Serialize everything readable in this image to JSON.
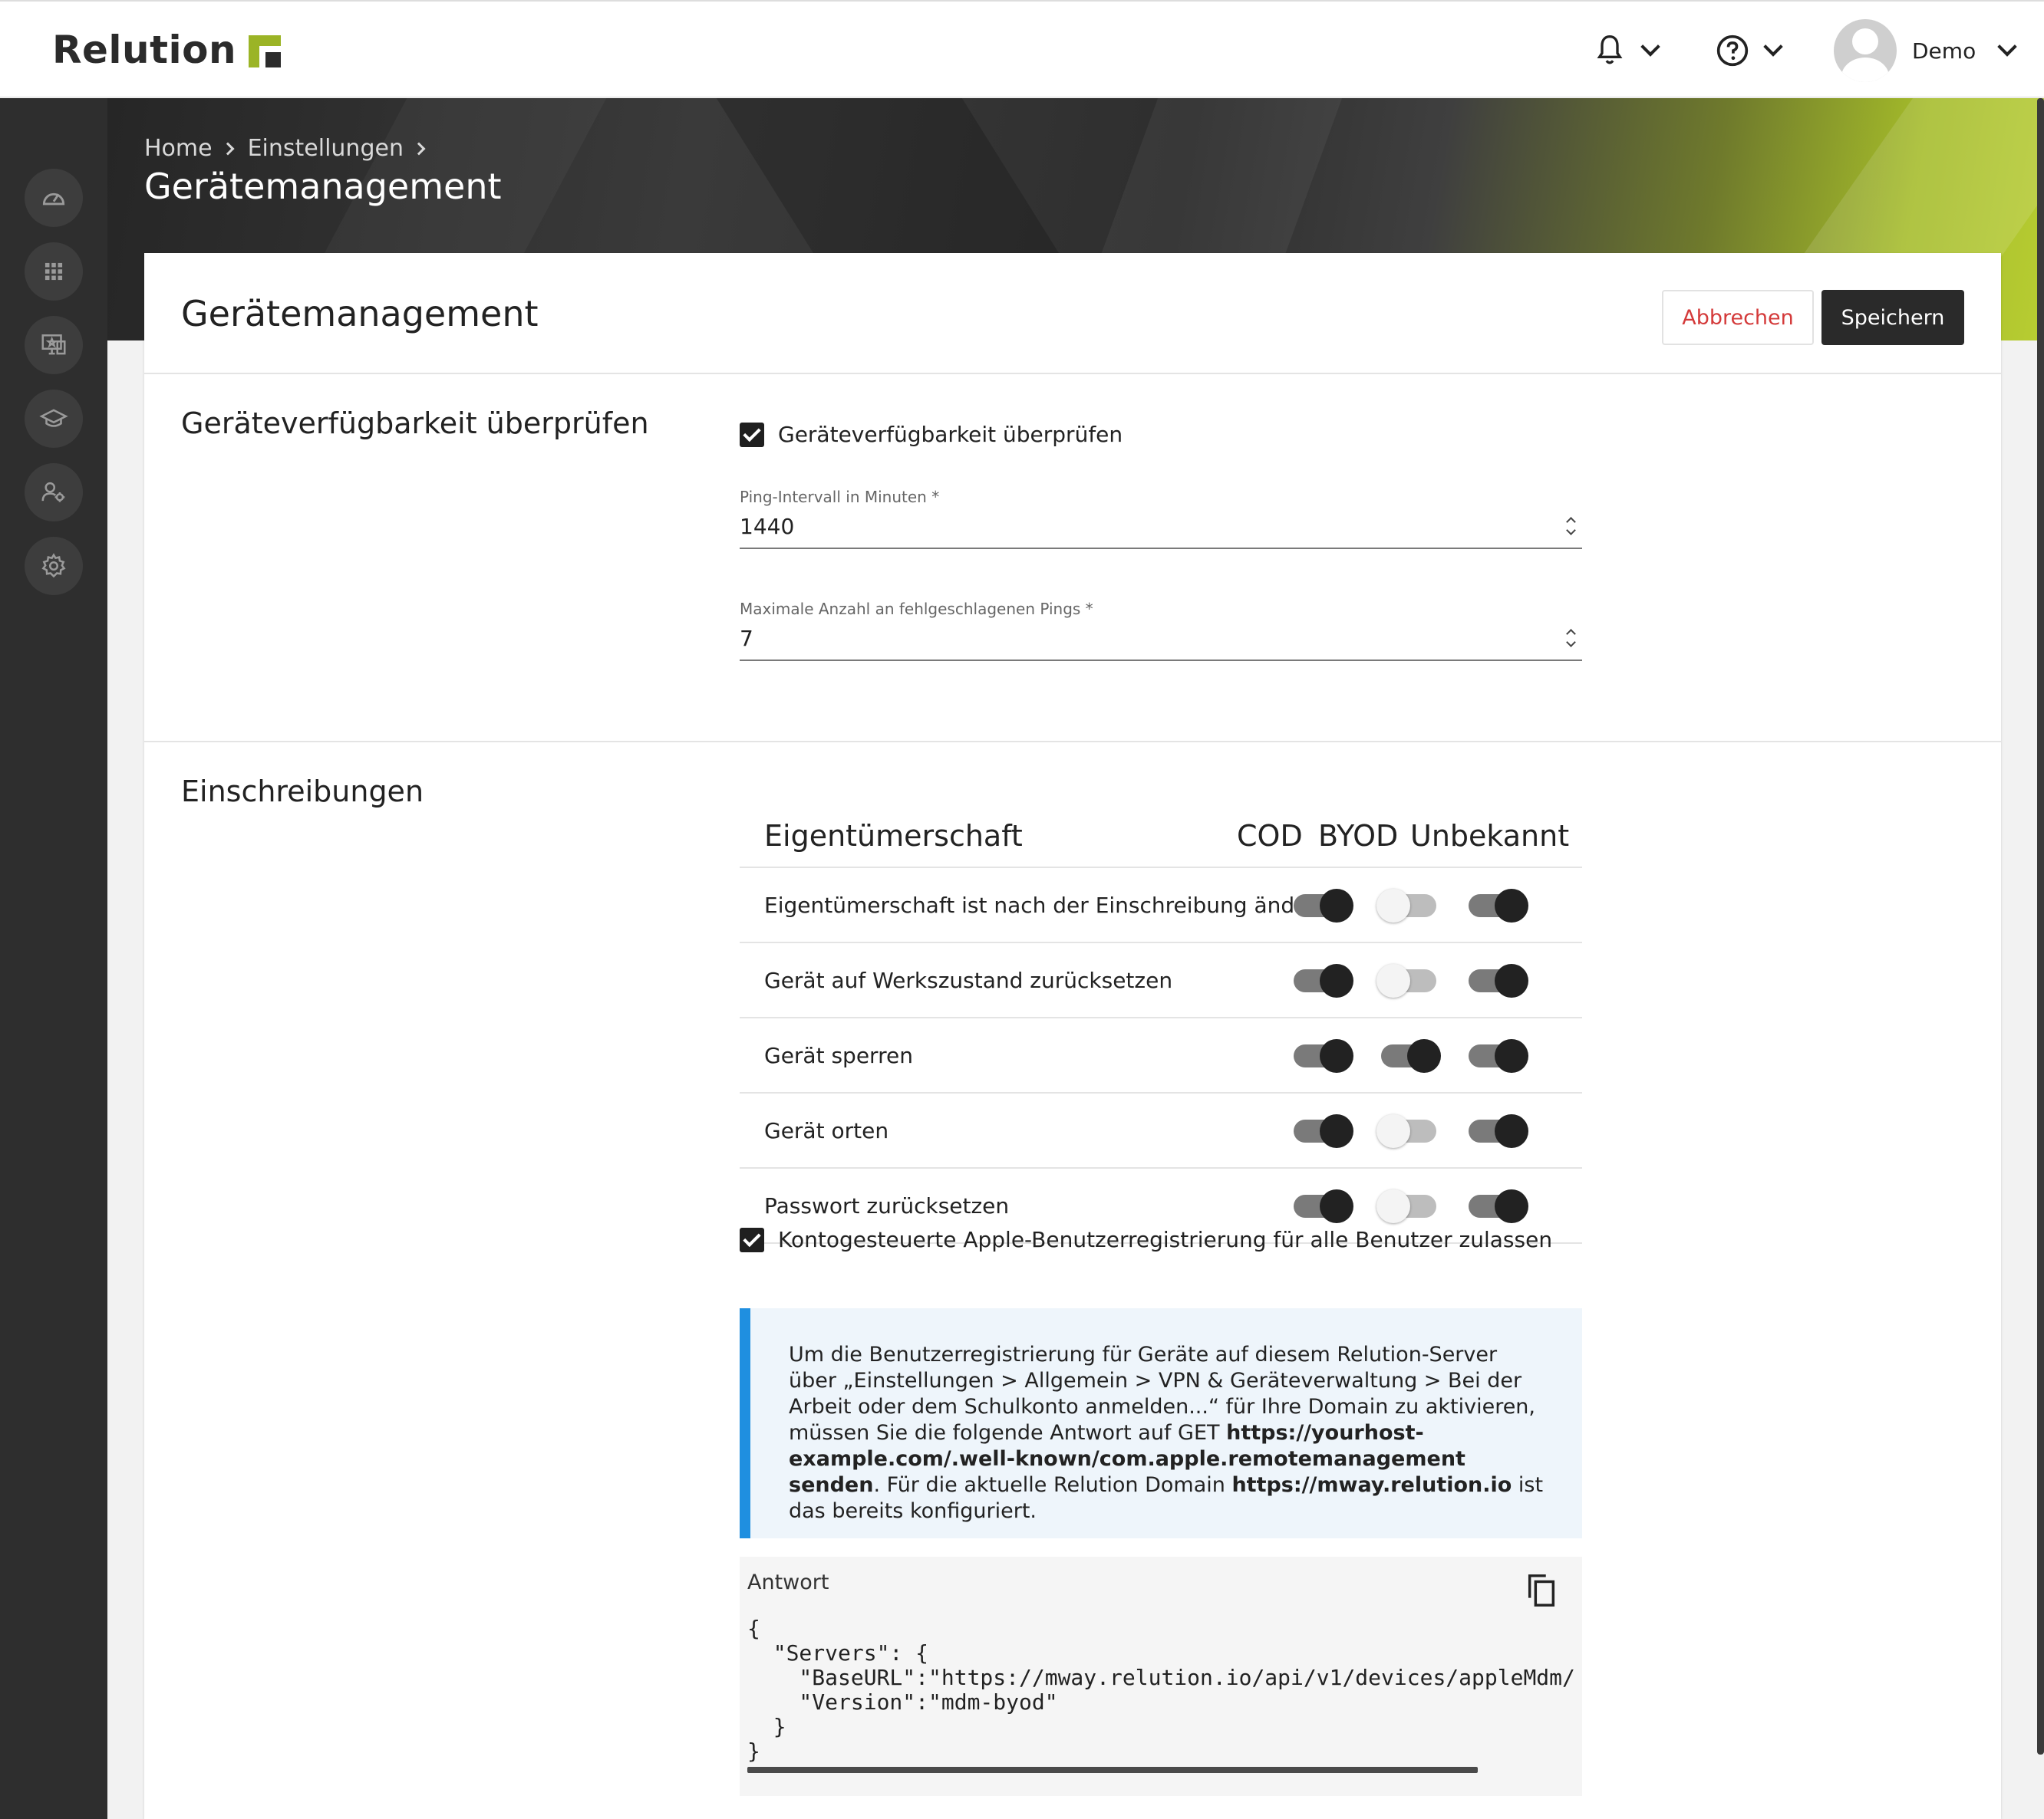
{
  "app": {
    "logo_text": "Relution",
    "brand_color": "#9bb426"
  },
  "topbar": {
    "user_name": "Demo",
    "icons": [
      "bell-icon",
      "help-icon",
      "user-avatar"
    ]
  },
  "sidebar": {
    "items": [
      "dashboard-icon",
      "apps-icon",
      "devices-icon",
      "education-icon",
      "users-icon",
      "settings-icon"
    ]
  },
  "breadcrumb": {
    "items": [
      "Home",
      "Einstellungen"
    ]
  },
  "page": {
    "title": "Gerätemanagement"
  },
  "card": {
    "title": "Gerätemanagement",
    "cancel_label": "Abbrechen",
    "save_label": "Speichern"
  },
  "availability": {
    "section_title": "Geräteverfügbarkeit überprüfen",
    "check_label": "Geräteverfügbarkeit überprüfen",
    "checked": true,
    "ping_label": "Ping-Intervall in Minuten *",
    "ping_value": "1440",
    "max_fail_label": "Maximale Anzahl an fehlgeschlagenen Pings *",
    "max_fail_value": "7"
  },
  "enrollment": {
    "section_title": "Einschreibungen",
    "table_title": "Eigentümerschaft",
    "columns": [
      "COD",
      "BYOD",
      "Unbekannt"
    ],
    "rows": [
      {
        "label": "Eigentümerschaft ist nach der Einschreibung änderbar",
        "cod": true,
        "byod": false,
        "unknown": true
      },
      {
        "label": "Gerät auf Werkszustand zurücksetzen",
        "cod": true,
        "byod": false,
        "unknown": true
      },
      {
        "label": "Gerät sperren",
        "cod": true,
        "byod": true,
        "unknown": true
      },
      {
        "label": "Gerät orten",
        "cod": true,
        "byod": false,
        "unknown": true
      },
      {
        "label": "Passwort zurücksetzen",
        "cod": true,
        "byod": false,
        "unknown": true
      }
    ],
    "apple_check_label": "Kontogesteuerte Apple-Benutzerregistrierung für alle Benutzer zulassen",
    "apple_checked": true,
    "info": {
      "text_1": "Um die Benutzerregistrierung für Geräte auf diesem Relution-Server über „Einstellungen > Allgemein > VPN & Geräteverwaltung > Bei der Arbeit oder dem Schulkonto anmelden...“ für Ihre Domain zu aktivieren, müssen Sie die folgende Antwort auf GET ",
      "url_1": "https://yourhost-example.com/.well-known/com.apple.remotemanagement senden",
      "text_2": ". Für die aktuelle Relution Domain ",
      "url_2": "https://mway.relution.io",
      "text_3": " ist das bereits konfiguriert."
    },
    "response": {
      "label": "Antwort",
      "code": "{\n  \"Servers\": {\n    \"BaseURL\":\"https://mway.relution.io/api/v1/devices/appleMdm/\n    \"Version\":\"mdm-byod\"\n  }\n}"
    }
  }
}
